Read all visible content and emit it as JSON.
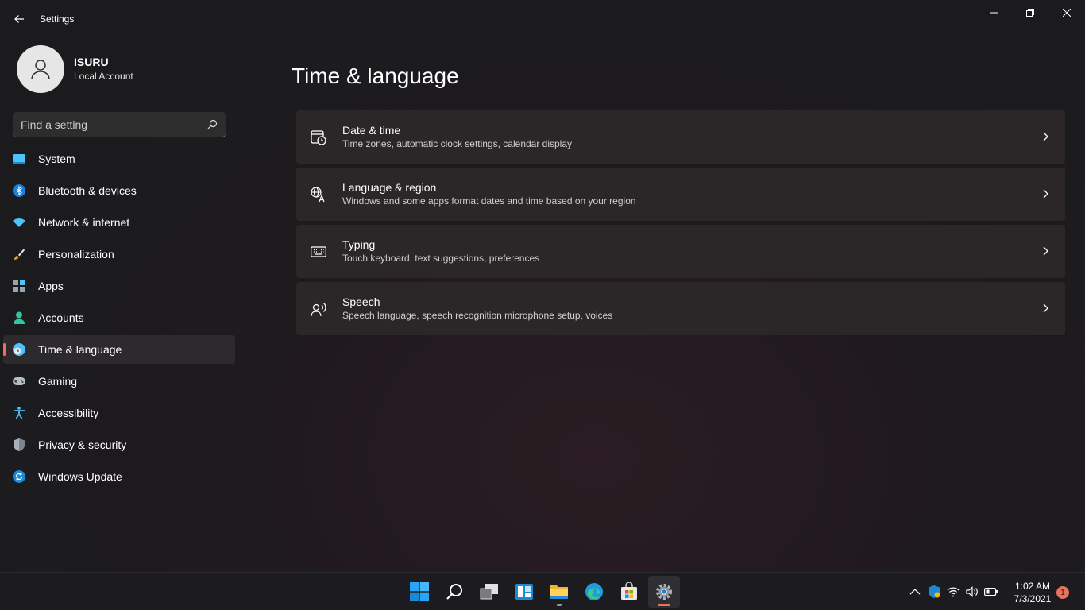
{
  "window": {
    "title": "Settings",
    "back_icon": "back-arrow-icon",
    "controls": [
      "minimize",
      "maximize",
      "close"
    ]
  },
  "profile": {
    "name": "ISURU",
    "account_type": "Local Account"
  },
  "search": {
    "placeholder": "Find a setting"
  },
  "sidebar": {
    "items": [
      {
        "label": "System",
        "icon": "monitor-icon",
        "active": false
      },
      {
        "label": "Bluetooth & devices",
        "icon": "bluetooth-icon",
        "active": false
      },
      {
        "label": "Network & internet",
        "icon": "wifi-icon",
        "active": false
      },
      {
        "label": "Personalization",
        "icon": "brush-icon",
        "active": false
      },
      {
        "label": "Apps",
        "icon": "apps-icon",
        "active": false
      },
      {
        "label": "Accounts",
        "icon": "person-icon",
        "active": false
      },
      {
        "label": "Time & language",
        "icon": "globe-clock-icon",
        "active": true
      },
      {
        "label": "Gaming",
        "icon": "gamepad-icon",
        "active": false
      },
      {
        "label": "Accessibility",
        "icon": "accessibility-icon",
        "active": false
      },
      {
        "label": "Privacy & security",
        "icon": "shield-icon",
        "active": false
      },
      {
        "label": "Windows Update",
        "icon": "refresh-icon",
        "active": false
      }
    ]
  },
  "main": {
    "title": "Time & language",
    "cards": [
      {
        "title": "Date & time",
        "description": "Time zones, automatic clock settings, calendar display",
        "icon": "calendar-clock-icon"
      },
      {
        "title": "Language & region",
        "description": "Windows and some apps format dates and time based on your region",
        "icon": "language-icon"
      },
      {
        "title": "Typing",
        "description": "Touch keyboard, text suggestions, preferences",
        "icon": "keyboard-icon"
      },
      {
        "title": "Speech",
        "description": "Speech language, speech recognition microphone setup, voices",
        "icon": "speech-icon"
      }
    ]
  },
  "taskbar": {
    "apps": [
      {
        "name": "start",
        "icon": "windows-logo-icon"
      },
      {
        "name": "search",
        "icon": "search-icon"
      },
      {
        "name": "task-view",
        "icon": "task-view-icon"
      },
      {
        "name": "widgets",
        "icon": "widgets-icon"
      },
      {
        "name": "file-explorer",
        "icon": "folder-icon"
      },
      {
        "name": "edge",
        "icon": "edge-icon"
      },
      {
        "name": "store",
        "icon": "store-icon"
      },
      {
        "name": "settings",
        "icon": "gear-icon"
      }
    ],
    "tray": [
      "chevron-up-icon",
      "defender-icon",
      "wifi-icon",
      "volume-icon",
      "battery-icon"
    ],
    "time": "1:02 AM",
    "date": "7/3/2021",
    "notification_count": "1"
  },
  "colors": {
    "accent": "#e8735a",
    "background": "#1f1b1e",
    "card": "#2b2729"
  }
}
